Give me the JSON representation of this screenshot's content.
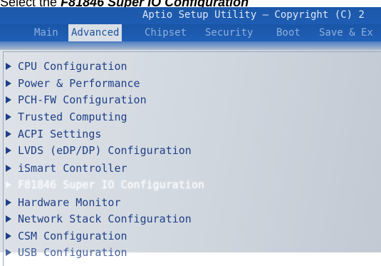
{
  "instruction": {
    "prefix": "Select the ",
    "emphasis": "F81846 Super IO Configuration"
  },
  "header": {
    "title": "Aptio Setup Utility – Copyright (C) 2"
  },
  "tabs": [
    {
      "label": "Main"
    },
    {
      "label": "Advanced"
    },
    {
      "label": "Chipset"
    },
    {
      "label": "Security"
    },
    {
      "label": "Boot"
    },
    {
      "label": "Save & Ex"
    }
  ],
  "menu": {
    "items": [
      {
        "label": "CPU Configuration"
      },
      {
        "label": "Power & Performance"
      },
      {
        "label": "PCH-FW Configuration"
      },
      {
        "label": "Trusted Computing"
      },
      {
        "label": "ACPI Settings"
      },
      {
        "label": "LVDS (eDP/DP) Configuration"
      },
      {
        "label": "iSmart Controller"
      },
      {
        "label": "F81846 Super IO Configuration"
      },
      {
        "label": "Hardware Monitor"
      },
      {
        "label": "Network Stack Configuration"
      },
      {
        "label": "CSM Configuration"
      },
      {
        "label": "USB Configuration"
      }
    ],
    "selected_index": 7
  },
  "colors": {
    "header_bg": "#1e5db5",
    "active_tab_bg": "#d9dfe6",
    "item_text": "#1f3f86",
    "selected_text": "#f4f6fa"
  }
}
